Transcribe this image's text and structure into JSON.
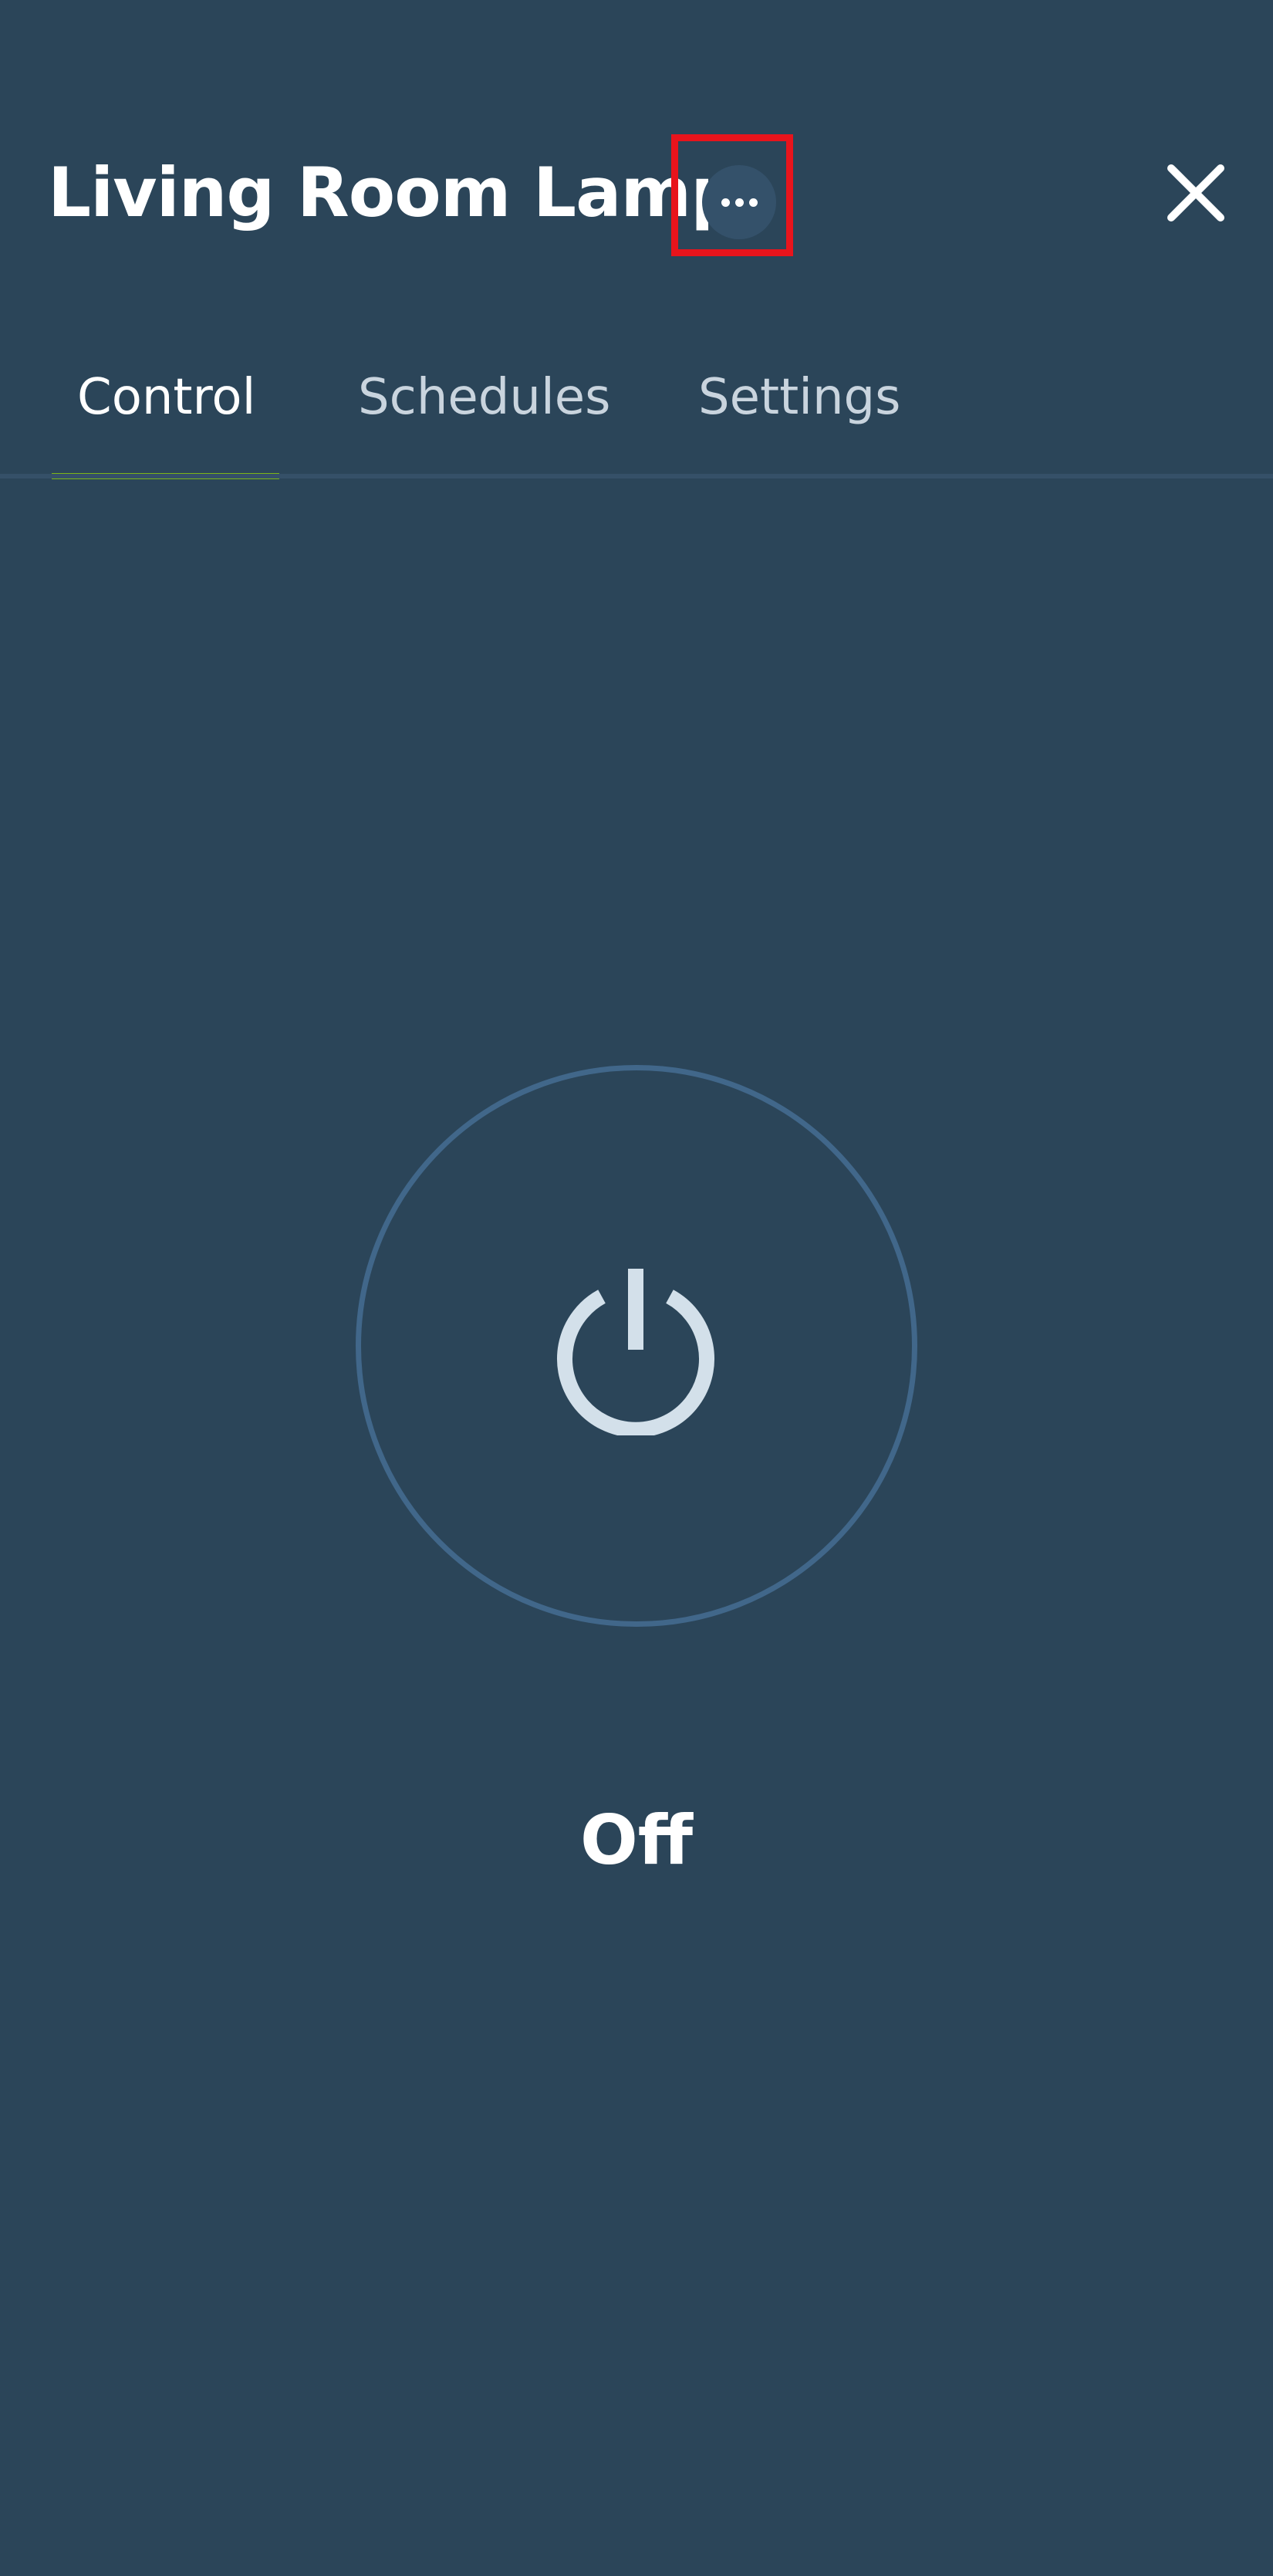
{
  "header": {
    "title": "Living Room Lamp",
    "more_icon": "more-horizontal-icon",
    "close_icon": "close-icon"
  },
  "tabs": [
    {
      "label": "Control",
      "active": true
    },
    {
      "label": "Schedules",
      "active": false
    },
    {
      "label": "Settings",
      "active": false
    }
  ],
  "control": {
    "power_icon": "power-icon",
    "state": "Off"
  },
  "colors": {
    "background": "#2b4559",
    "accent": "#7cb518",
    "ring": "#41678a",
    "highlight": "#e8141c"
  }
}
